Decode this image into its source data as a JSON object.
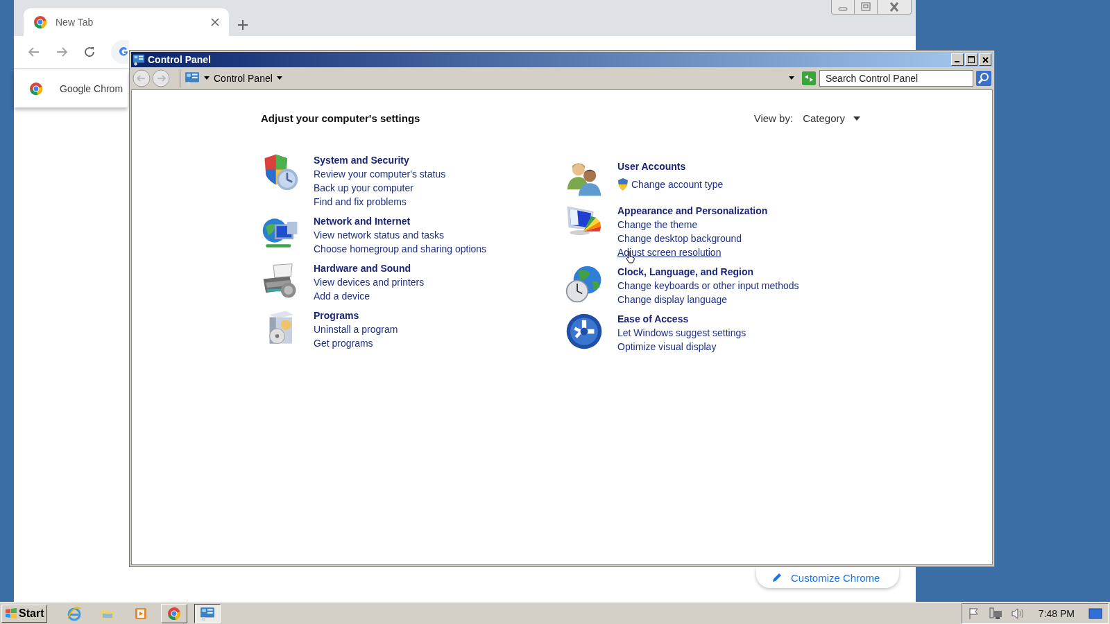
{
  "chrome": {
    "tabs": [
      {
        "title": "New Tab",
        "selected": true
      }
    ],
    "panel_item": "Google Chrom",
    "customize_button": "Customize Chrome"
  },
  "control_panel": {
    "title": "Control Panel",
    "breadcrumb": "Control Panel",
    "search": {
      "placeholder": "Search Control Panel"
    },
    "heading": "Adjust your computer's settings",
    "view_by": {
      "label": "View by:",
      "value": "Category"
    },
    "columns": [
      {
        "categories": [
          {
            "kind": "security",
            "title": "System and Security",
            "links": [
              {
                "text": "Review your computer's status",
                "elevated": false,
                "hovered": false
              },
              {
                "text": "Back up your computer",
                "elevated": false,
                "hovered": false
              },
              {
                "text": "Find and fix problems",
                "elevated": false,
                "hovered": false
              }
            ]
          },
          {
            "kind": "network",
            "title": "Network and Internet",
            "links": [
              {
                "text": "View network status and tasks",
                "elevated": false,
                "hovered": false
              },
              {
                "text": "Choose homegroup and sharing options",
                "elevated": false,
                "hovered": false
              }
            ]
          },
          {
            "kind": "hardware",
            "title": "Hardware and Sound",
            "links": [
              {
                "text": "View devices and printers",
                "elevated": false,
                "hovered": false
              },
              {
                "text": "Add a device",
                "elevated": false,
                "hovered": false
              }
            ]
          },
          {
            "kind": "programs",
            "title": "Programs",
            "links": [
              {
                "text": "Uninstall a program",
                "elevated": false,
                "hovered": false
              },
              {
                "text": "Get programs",
                "elevated": false,
                "hovered": false
              }
            ]
          }
        ]
      },
      {
        "categories": [
          {
            "kind": "accounts",
            "title": "User Accounts",
            "links": [
              {
                "text": "Change account type",
                "elevated": true,
                "hovered": false
              }
            ]
          },
          {
            "kind": "appearance",
            "title": "Appearance and Personalization",
            "links": [
              {
                "text": "Change the theme",
                "elevated": false,
                "hovered": false
              },
              {
                "text": "Change desktop background",
                "elevated": false,
                "hovered": false
              },
              {
                "text": "Adjust screen resolution",
                "elevated": false,
                "hovered": true
              }
            ]
          },
          {
            "kind": "clock",
            "title": "Clock, Language, and Region",
            "links": [
              {
                "text": "Change keyboards or other input methods",
                "elevated": false,
                "hovered": false
              },
              {
                "text": "Change display language",
                "elevated": false,
                "hovered": false
              }
            ]
          },
          {
            "kind": "access",
            "title": "Ease of Access",
            "links": [
              {
                "text": "Let Windows suggest settings",
                "elevated": false,
                "hovered": false
              },
              {
                "text": "Optimize visual display",
                "elevated": false,
                "hovered": false
              }
            ]
          }
        ]
      }
    ]
  },
  "taskbar": {
    "start": "Start",
    "apps": [
      {
        "kind": "ie",
        "open": false,
        "selected": false
      },
      {
        "kind": "explorer",
        "open": false,
        "selected": false
      },
      {
        "kind": "media",
        "open": false,
        "selected": false
      },
      {
        "kind": "chrome",
        "open": true,
        "selected": false
      },
      {
        "kind": "control_panel",
        "open": true,
        "selected": true
      }
    ],
    "clock": "7:48 PM"
  }
}
